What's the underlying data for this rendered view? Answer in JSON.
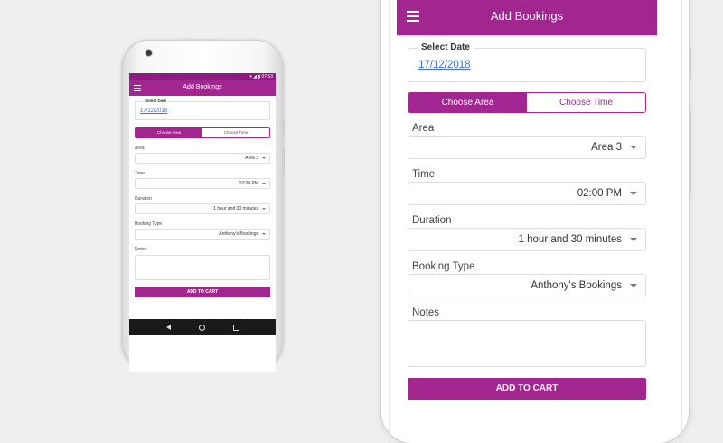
{
  "app": {
    "title": "Add Bookings",
    "status_time": "07:53"
  },
  "date": {
    "label": "Select Date",
    "value": "17/12/2018"
  },
  "toggle": {
    "area_label": "Choose Area",
    "time_label": "Choose Time",
    "selected": "Choose Area"
  },
  "fields": {
    "area": {
      "label": "Area",
      "value": "Area 3"
    },
    "time": {
      "label": "Time",
      "value": "02:00 PM"
    },
    "duration": {
      "label": "Duration",
      "value": "1 hour and 30 minutes"
    },
    "booking_type": {
      "label": "Booking Type",
      "value": "Anthony's Bookings"
    },
    "notes": {
      "label": "Notes",
      "value": ""
    }
  },
  "actions": {
    "add_to_cart": "ADD TO CART"
  },
  "colors": {
    "primary": "#a1268f",
    "primary_dark": "#8e1c80",
    "link": "#3f6fd8",
    "background": "#efefef"
  },
  "icons": [
    "menu-icon",
    "dropdown-arrow-icon",
    "back-icon",
    "home-icon",
    "recents-icon",
    "wifi-icon",
    "battery-icon"
  ]
}
